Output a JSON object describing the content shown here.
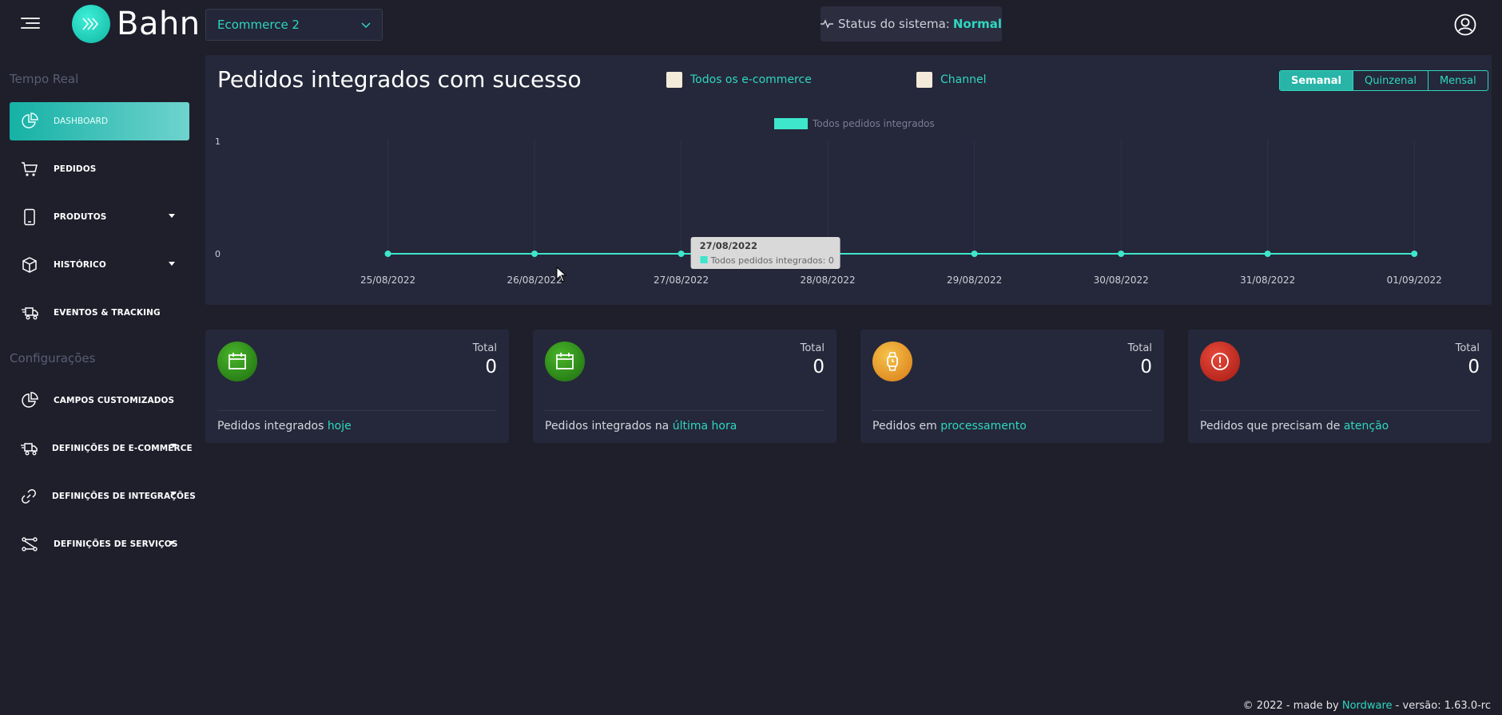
{
  "header": {
    "logo_text": "Bahn",
    "store_select": "Ecommerce 2",
    "status_label": "Status do sistema:",
    "status_value": "Normal"
  },
  "sidebar": {
    "section_realtime": "Tempo Real",
    "section_config": "Configurações",
    "items": [
      {
        "label": "DASHBOARD",
        "icon": "pie-chart-icon",
        "active": true
      },
      {
        "label": "PEDIDOS",
        "icon": "cart-icon"
      },
      {
        "label": "PRODUTOS",
        "icon": "tablet-icon",
        "has_caret": true
      },
      {
        "label": "HISTÓRICO",
        "icon": "box-icon",
        "has_caret": true
      },
      {
        "label": "EVENTOS & TRACKING",
        "icon": "truck-icon"
      },
      {
        "label": "CAMPOS CUSTOMIZADOS",
        "icon": "pie-chart-icon"
      },
      {
        "label": "DEFINIÇÕES DE E-COMMERCE",
        "icon": "truck-icon",
        "has_caret": true
      },
      {
        "label": "DEFINIÇÕES DE INTEGRAÇÕES",
        "icon": "link-icon",
        "has_caret": true
      },
      {
        "label": "DEFINIÇÕES DE SERVIÇOS",
        "icon": "nodes-icon",
        "has_caret": true
      }
    ]
  },
  "chart_panel": {
    "title": "Pedidos integrados com sucesso",
    "filter_all": "Todos os e-commerce",
    "filter_channel": "Channel",
    "periods": [
      "Semanal",
      "Quinzenal",
      "Mensal"
    ],
    "active_period": "Semanal"
  },
  "chart_data": {
    "type": "line",
    "title": "",
    "xlabel": "",
    "ylabel": "",
    "ylim": [
      0,
      1
    ],
    "y_ticks": [
      "1",
      "0"
    ],
    "categories": [
      "25/08/2022",
      "26/08/2022",
      "27/08/2022",
      "28/08/2022",
      "29/08/2022",
      "30/08/2022",
      "31/08/2022",
      "01/09/2022"
    ],
    "series": [
      {
        "name": "Todos pedidos integrados",
        "values": [
          0,
          0,
          0,
          0,
          0,
          0,
          0,
          0
        ],
        "color": "#3ee6cc"
      }
    ],
    "legend_position": "top-center",
    "tooltip": {
      "title": "27/08/2022",
      "label": "Todos pedidos integrados: 0",
      "index": 2
    }
  },
  "cards": [
    {
      "total_label": "Total",
      "total": "0",
      "desc": "Pedidos integrados ",
      "highlight": "hoje",
      "icon": "calendar-icon",
      "color": "#2a8a1a"
    },
    {
      "total_label": "Total",
      "total": "0",
      "desc": "Pedidos integrados na ",
      "highlight": "última hora",
      "icon": "calendar-icon",
      "color": "#2a8a1a"
    },
    {
      "total_label": "Total",
      "total": "0",
      "desc": "Pedidos em ",
      "highlight": "processamento",
      "icon": "watch-icon",
      "color": "#e89a25"
    },
    {
      "total_label": "Total",
      "total": "0",
      "desc": "Pedidos que precisam de ",
      "highlight": "atenção",
      "icon": "alert-icon",
      "color": "#c2261b"
    }
  ],
  "footer": {
    "prefix": "© 2022 - made by ",
    "brand": "Nordware",
    "suffix": " - versão: 1.63.0-rc"
  }
}
